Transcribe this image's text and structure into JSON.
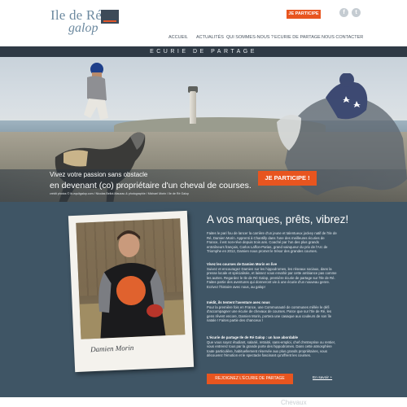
{
  "header": {
    "logo_line1": "Ile de Ré",
    "logo_line2": "galop",
    "participate_label": "JE PARTICIPE",
    "social": {
      "facebook": "f",
      "twitter": "t"
    },
    "nav": [
      "ACCUEIL",
      "ACTUALITÉS",
      "QUI SOMMES-NOUS ?",
      "ECURIE DE PARTAGE",
      "NOUS CONTACTER"
    ]
  },
  "banner": {
    "title": "ECURIE DE PARTAGE"
  },
  "hero": {
    "caption_line1": "Vivez votre passion sans obstacle",
    "caption_line2": "en devenant (co) propriétaire d'un cheval de courses.",
    "credit": "crédit photos © ib-equitgalop.com / Nicolas Bellot-Mauzau & photographie / Michael Morin / Ile de Ré Galop",
    "cta_label": "JE PARTICIPE !"
  },
  "main": {
    "title": "A vos marques, prêts, vibrez!",
    "signature": "Damien Morin",
    "paragraphs": [
      {
        "heading": "",
        "text": "Faites le pari fou de lancer la carrière d'un jeune et talentueux jockey natif de l'Ile de Ré, Damien Morin. Apprenti à Chantilly dans l'une des meilleures écuries de France, il est non-réve depuis trois ans. Coaché par l'un des plus grands entraîneurs français, Carlos Laffon-Parias, grand vainqueur du prix de l'Arc de Triomphe en 2012, Damien nous promet le trésor des grandes courses."
      },
      {
        "heading": "Vivez les courses de Damien Morin en live",
        "text": "Suivez et encouragez Damien sur les hippodromes, les réseaux sociaux, dans la presse locale et spécialisée, et laissez vous envahir par cette ambiance pas comme les autres. Regardez le Ile de Ré Galop, première écurie de partage sur l'Ile de Ré. Faites partie des aventures qui donneront vie à une écurie d'un nouveau genre. Ecrivez l'histoire avec nous, au galop!"
      },
      {
        "heading": "Inédit, ils tentent l'aventure avec nous",
        "text": "Pour la première fois en France, une Communauté de communes mêlée le défi d'accompagner une écurie de chevaux de courses. Parce que sur l'Ile de Ré, les gens rêvent encore, Damien Morin, portera une casaque aux couleurs de son île natale ! Faites partie des chanceux !"
      },
      {
        "heading": "L'écurie de partage Ile de Ré Galop : un luxe abordable",
        "text": "Que vous soyez étudiant, salarié, retraité, sans-emploi, chef d'entreprise ou rentier, vous entrerez tous par la grande porte des hippodromes. Dans cette atmosphère toute particulière, habituellement réservée aux plus grands propriétaires, vous découvrez l'émotion et le spectacle fascinant qu'offrent les courses."
      }
    ],
    "join_label": "REJOIGNEZ L'ÉCURIE DE PARTAGE",
    "more_label": "En savoir +"
  },
  "footer_peek": {
    "text": "Chevaux"
  }
}
